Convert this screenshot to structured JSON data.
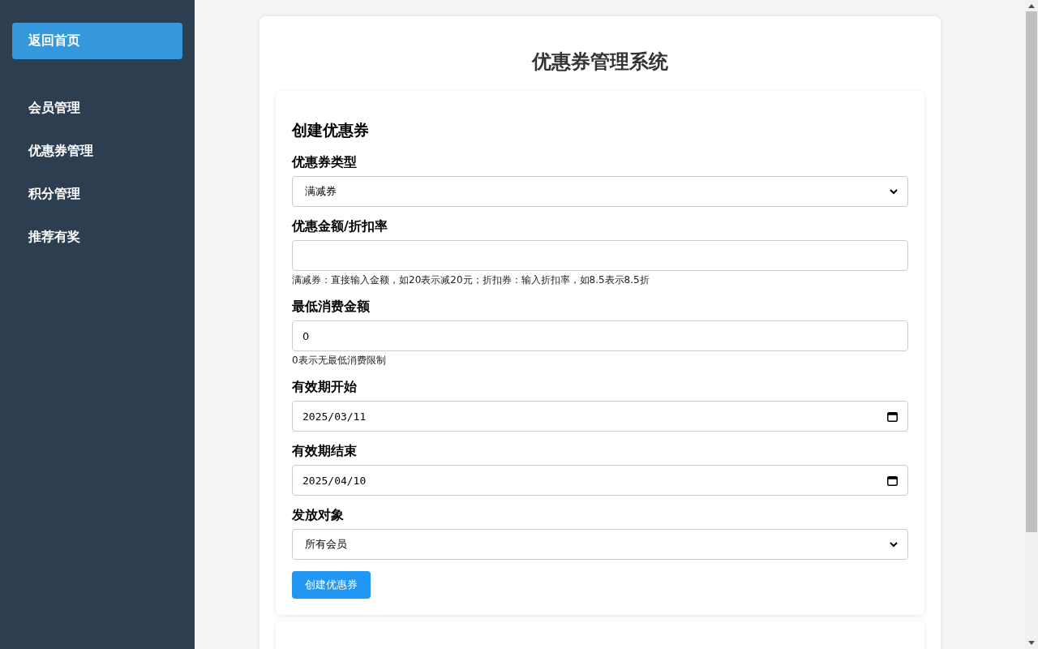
{
  "sidebar": {
    "items": [
      {
        "label": "返回首页",
        "selected": true
      },
      {
        "label": "会员管理",
        "selected": false
      },
      {
        "label": "优惠券管理",
        "selected": false
      },
      {
        "label": "积分管理",
        "selected": false
      },
      {
        "label": "推荐有奖",
        "selected": false
      }
    ]
  },
  "page_title": "优惠券管理系统",
  "form": {
    "title": "创建优惠券",
    "fields": [
      {
        "kind": "select",
        "label": "优惠券类型",
        "value": "满减券"
      },
      {
        "kind": "text",
        "label": "优惠金额/折扣率",
        "hint": "满减券：直接输入金额，如20表示减20元；折扣券：输入折扣率，如8.5表示8.5折"
      },
      {
        "kind": "text",
        "label": "最低消费金额",
        "value": "0",
        "hint": "0表示无最低消费限制"
      },
      {
        "kind": "date",
        "label": "有效期开始",
        "value": "2025/03/11"
      },
      {
        "kind": "date",
        "label": "有效期结束",
        "value": "2025/04/10"
      },
      {
        "kind": "select",
        "label": "发放对象",
        "value": "所有会员"
      }
    ],
    "submit": "创建优惠券"
  }
}
